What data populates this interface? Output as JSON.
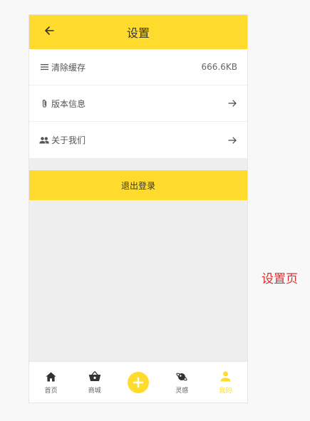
{
  "header": {
    "title": "设置",
    "back_icon": "arrow-left-icon"
  },
  "settings": {
    "items": [
      {
        "label": "清除缓存",
        "value": "666.6KB",
        "icon": "list-icon"
      },
      {
        "label": "版本信息",
        "icon": "paperclip-icon",
        "trailing_icon": "arrow-right-icon"
      },
      {
        "label": "关于我们",
        "icon": "people-icon",
        "trailing_icon": "arrow-right-icon"
      }
    ]
  },
  "logout": {
    "label": "退出登录"
  },
  "tabbar": {
    "tabs": [
      {
        "label": "首页",
        "icon": "home-icon"
      },
      {
        "label": "商城",
        "icon": "basket-icon"
      },
      {
        "label": "",
        "icon": "plus-icon"
      },
      {
        "label": "灵感",
        "icon": "planet-icon"
      },
      {
        "label": "我的",
        "icon": "person-icon",
        "active": true
      }
    ]
  },
  "caption": "设置页",
  "colors": {
    "accent": "#fedb2d",
    "background": "#eeeeee",
    "caption": "#d9302f"
  }
}
